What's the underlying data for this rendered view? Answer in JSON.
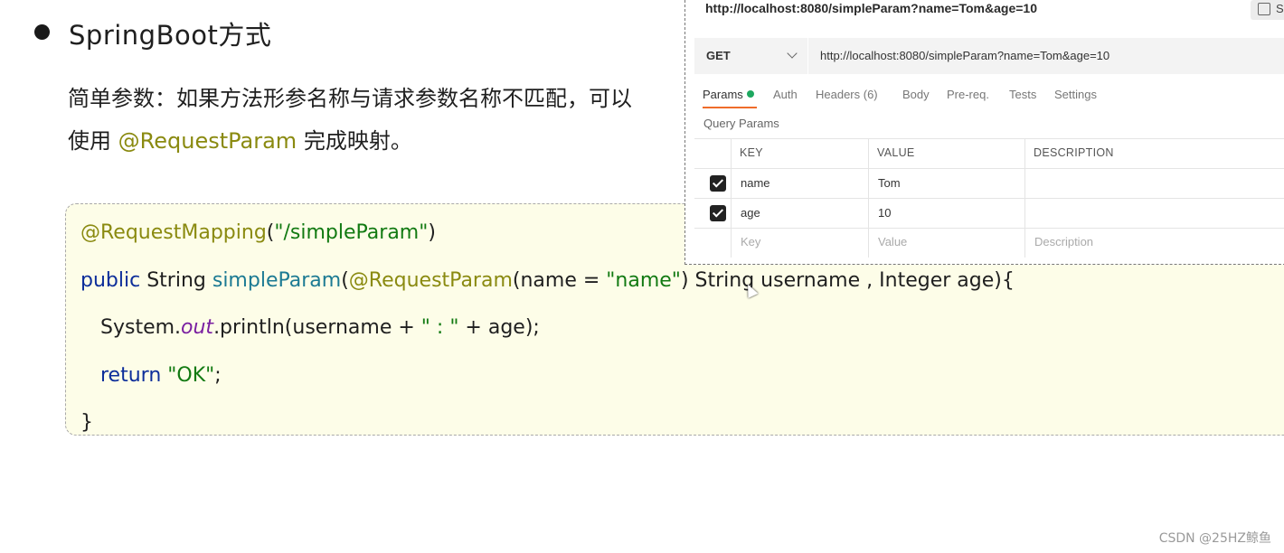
{
  "slide": {
    "title": "SpringBoot方式",
    "desc_line1": "简单参数：如果方法形参名称与请求参数名称不匹配，可以",
    "desc_line2_pre": "使用 ",
    "desc_line2_hl": "@RequestParam",
    "desc_line2_post": " 完成映射。"
  },
  "code": {
    "l1_ann": "@RequestMapping",
    "l1_open": "(",
    "l1_str": "\"/simpleParam\"",
    "l1_close": ")",
    "l2_kw": "public",
    "l2_a": " String ",
    "l2_fn": "simpleParam",
    "l2_b": "(",
    "l2_ann": "@RequestParam",
    "l2_c": "(name = ",
    "l2_str": "\"name\"",
    "l2_d": ") String username , Integer age){",
    "l3_a": "System.",
    "l3_field": "out",
    "l3_b": ".println(username + ",
    "l3_str": "\" : \"",
    "l3_c": " + age);",
    "l4_kw": "return",
    "l4_sp": " ",
    "l4_str": "\"OK\"",
    "l4_end": ";",
    "l5": "}"
  },
  "postman": {
    "url_title": "http://localhost:8080/simpleParam?name=Tom&age=10",
    "save_label": "S",
    "method": "GET",
    "url": "http://localhost:8080/simpleParam?name=Tom&age=10",
    "tabs": [
      "Params",
      "Auth",
      "Headers (6)",
      "Body",
      "Pre-req.",
      "Tests",
      "Settings"
    ],
    "query_params_label": "Query Params",
    "table": {
      "headers": [
        "KEY",
        "VALUE",
        "DESCRIPTION"
      ],
      "rows": [
        {
          "key": "name",
          "value": "Tom",
          "checked": true
        },
        {
          "key": "age",
          "value": "10",
          "checked": true
        }
      ],
      "placeholder": {
        "key": "Key",
        "value": "Value",
        "description": "Description"
      }
    }
  },
  "watermark": "CSDN @25HZ鲸鱼"
}
